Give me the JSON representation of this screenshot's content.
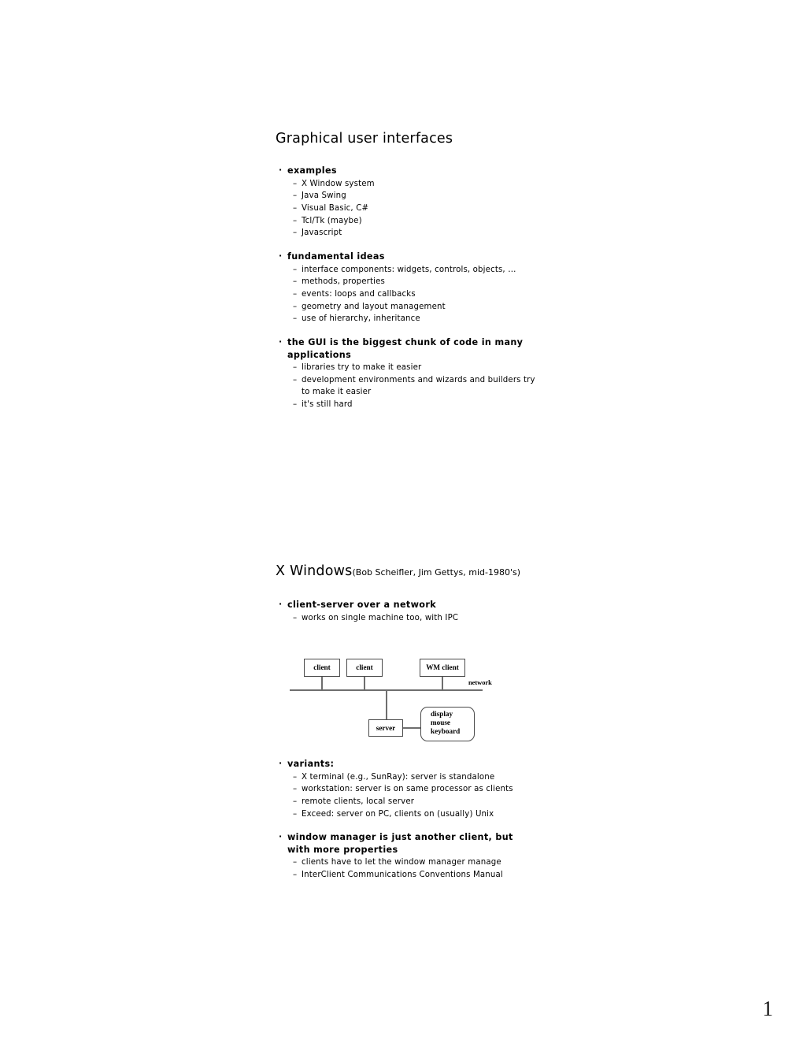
{
  "page": {
    "number": "1",
    "background_color": "#ffffff",
    "text_color": "#000000"
  },
  "slides": [
    {
      "title": "Graphical user interfaces",
      "subtitle": "",
      "groups": [
        {
          "heading": "examples",
          "marker": "·",
          "items": [
            "X Window system",
            "Java Swing",
            "Visual Basic, C#",
            "Tcl/Tk (maybe)",
            "Javascript"
          ]
        },
        {
          "heading": "fundamental ideas",
          "marker": "·",
          "items": [
            "interface components: widgets, controls, objects, …",
            "methods, properties",
            "events: loops and callbacks",
            "geometry and layout management",
            "use of hierarchy, inheritance"
          ]
        },
        {
          "heading": "the GUI is the biggest chunk of code in many applications",
          "marker": "·",
          "items": [
            "libraries try to make it easier",
            "development environments and wizards and builders try to make it easier",
            "it's still hard"
          ]
        }
      ]
    },
    {
      "title": "X Windows",
      "subtitle": "(Bob Scheifler, Jim Gettys, mid-1980's)",
      "groups": [
        {
          "heading": "client-server over a network",
          "marker": "·",
          "items": [
            "works on single machine too, with IPC"
          ]
        }
      ],
      "groups_after_diagram": [
        {
          "heading": "variants:",
          "marker": "·",
          "items": [
            "X terminal (e.g., SunRay): server is standalone",
            "workstation: server is on same processor as clients",
            "remote clients, local server",
            "Exceed: server on PC, clients on (usually) Unix"
          ]
        },
        {
          "heading": "window manager is just another client, but with more properties",
          "marker": "·",
          "items": [
            "clients have to let the window manager manage",
            "InterClient Communications Conventions Manual"
          ]
        }
      ]
    }
  ],
  "diagram": {
    "name": "x-window-client-server-diagram",
    "boxes": [
      {
        "id": "client-1",
        "label": "client"
      },
      {
        "id": "client-2",
        "label": "client"
      },
      {
        "id": "wm-client",
        "label": "WM client"
      },
      {
        "id": "server",
        "label": "server"
      }
    ],
    "device_box": {
      "id": "display-device",
      "lines": [
        "display",
        "mouse",
        "keyboard"
      ]
    },
    "bus_label": "network",
    "line_color": "#6e6e6e",
    "border_color": "#4a4a4a"
  }
}
